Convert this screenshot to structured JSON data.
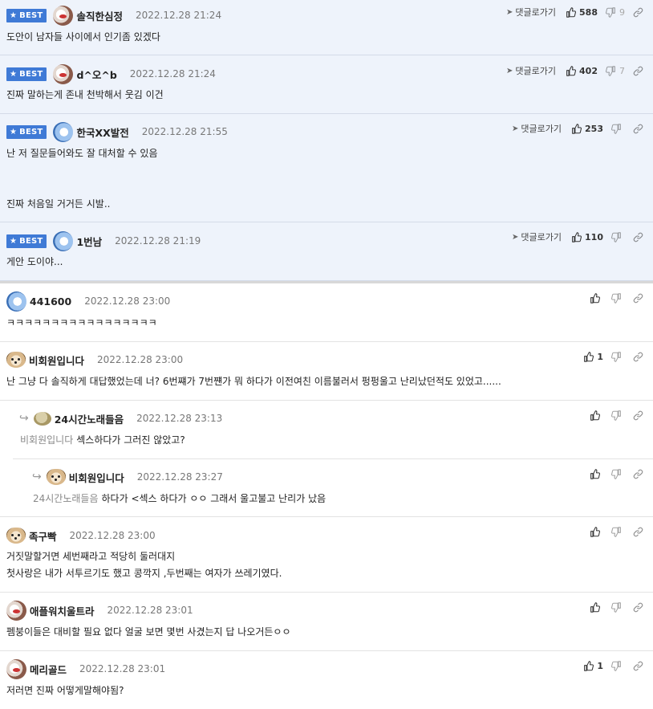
{
  "labels": {
    "best": "BEST",
    "reply": "댓글로가기"
  },
  "best_comments": [
    {
      "nick": "솔직한심정",
      "date": "2022.12.28 21:24",
      "up": "588",
      "down": "9",
      "avatar": "red-panda-avatar",
      "lines": [
        "도안이 남자들 사이에서 인기좀 있겠다"
      ]
    },
    {
      "nick": "d^오^b",
      "date": "2022.12.28 21:24",
      "up": "402",
      "down": "7",
      "avatar": "red-panda-avatar",
      "lines": [
        "진짜 말하는게 존내 천박해서 웃김 이건"
      ]
    },
    {
      "nick": "한국XX발전",
      "date": "2022.12.28 21:55",
      "up": "253",
      "down": "",
      "avatar": "blue-avatar",
      "lines": [
        "난 저 질문들어와도 잘 대처할 수 있음",
        "진짜 처음일 거거든 시발.."
      ]
    },
    {
      "nick": "1번남",
      "date": "2022.12.28 21:19",
      "up": "110",
      "down": "",
      "avatar": "blue-avatar",
      "lines": [
        "게안 도이야..."
      ]
    }
  ],
  "comments": [
    {
      "nick": "441600",
      "date": "2022.12.28 23:00",
      "up": "",
      "down": "",
      "avatar": "blue-avatar",
      "lines": [
        "ㅋㅋㅋㅋㅋㅋㅋㅋㅋㅋㅋㅋㅋㅋㅋㅋㅋ"
      ]
    },
    {
      "nick": "비회원입니다",
      "date": "2022.12.28 23:00",
      "up": "1",
      "down": "",
      "avatar": "dog-avatar",
      "lines": [
        "난 그냥 다 솔직하게 대답했었는데 너? 6번쨰가 7번쨴가 뭐 하다가 이전여친 이름불러서 펑펑울고 난리났던적도 있었고......"
      ]
    },
    {
      "nick": "24시간노래들음",
      "date": "2022.12.28 23:13",
      "up": "",
      "down": "",
      "avatar": "blob-avatar",
      "mention": "비회원입니다",
      "lines": [
        "섹스하다가 그러진 않았고?"
      ]
    },
    {
      "nick": "비회원입니다",
      "date": "2022.12.28 23:27",
      "up": "",
      "down": "",
      "avatar": "dog-avatar",
      "mention": "24시간노래들음",
      "lines": [
        "하다가 <섹스 하다가 ㅇㅇ 그래서 울고불고 난리가 났음"
      ]
    },
    {
      "nick": "족구빡",
      "date": "2022.12.28 23:00",
      "up": "",
      "down": "",
      "avatar": "dog-avatar",
      "lines": [
        "거짓말할거면 세번째라고 적당히 둘러대지",
        "첫사랑은 내가 서투르기도 했고 콩깍지 ,두번째는 여자가 쓰레기였다."
      ]
    },
    {
      "nick": "애플워치울트라",
      "date": "2022.12.28 23:01",
      "up": "",
      "down": "",
      "avatar": "red-panda-avatar",
      "lines": [
        "펨붕이들은 대비할 필요 없다 얼굴 보면 몇번 사겼는지 답 나오거든ㅇㅇ"
      ]
    },
    {
      "nick": "메리골드",
      "date": "2022.12.28 23:01",
      "up": "1",
      "down": "",
      "avatar": "red-panda-avatar",
      "lines": [
        "저러면 진짜 어떻게말해야됨?"
      ]
    }
  ]
}
